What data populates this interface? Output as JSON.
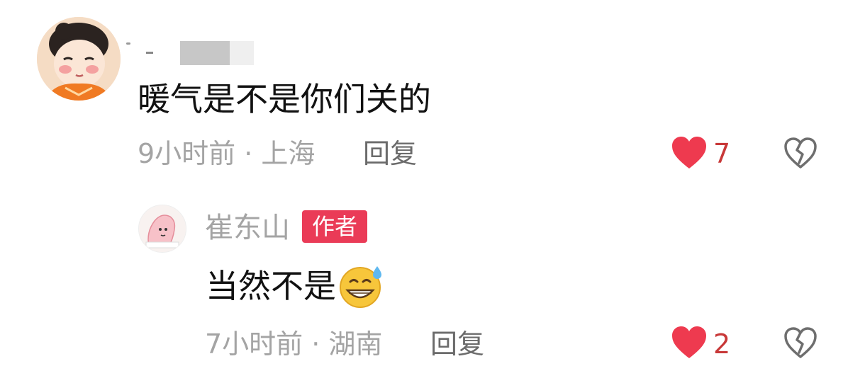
{
  "comment": {
    "text": "暖气是不是你们关的",
    "meta": "9小时前 · 上海",
    "reply_label": "回复",
    "like_count": "7",
    "colors": {
      "like": "#ee3a4f",
      "meta": "#a4a4a4",
      "text": "#111111"
    }
  },
  "reply": {
    "author": "崔东山",
    "author_badge": "作者",
    "text": "当然不是",
    "emoji": "grinning-sweat-emoji",
    "meta": "7小时前 · 湖南",
    "reply_label": "回复",
    "like_count": "2",
    "colors": {
      "badge": "#ea3b57"
    }
  },
  "icons": {
    "like": "heart-filled-icon",
    "dislike": "broken-heart-icon"
  }
}
